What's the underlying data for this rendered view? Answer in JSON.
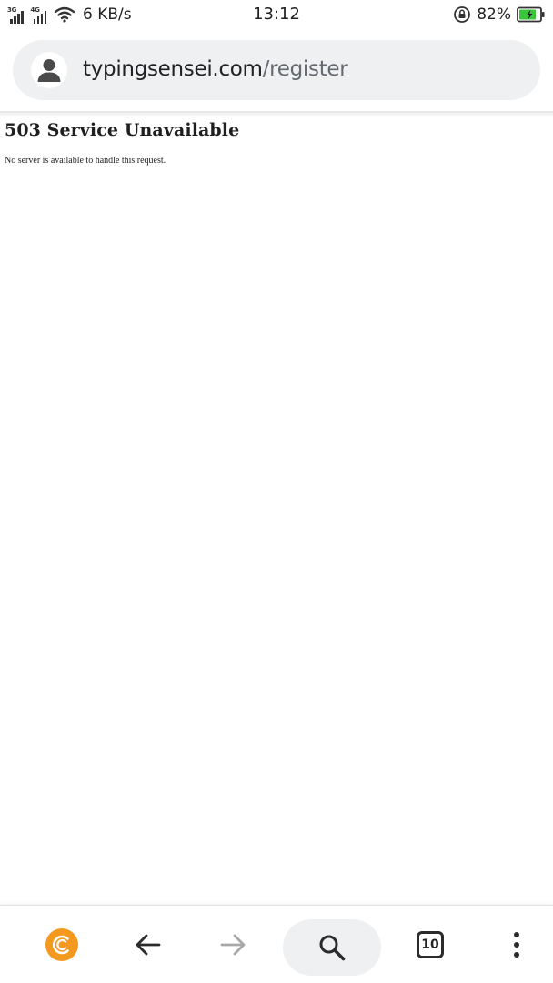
{
  "status_bar": {
    "network_1": "3G",
    "network_2": "4G",
    "speed": "6 KB/s",
    "time": "13:12",
    "battery_percent": "82%",
    "battery_level": 0.82
  },
  "browser": {
    "url_domain": "typingsensei.com",
    "url_path": "/register",
    "open_tabs": "10"
  },
  "page": {
    "heading": "503 Service Unavailable",
    "message": "No server is available to handle this request."
  },
  "icons": {
    "site": "user-avatar-icon",
    "home": "browser-logo-icon",
    "back": "arrow-left-icon",
    "forward": "arrow-right-icon",
    "search": "search-icon",
    "tabs": "tabs-icon",
    "menu": "more-vert-icon"
  },
  "colors": {
    "accent": "#f39a1e",
    "battery": "#3cc43c",
    "pill_bg": "#eff0f1"
  }
}
